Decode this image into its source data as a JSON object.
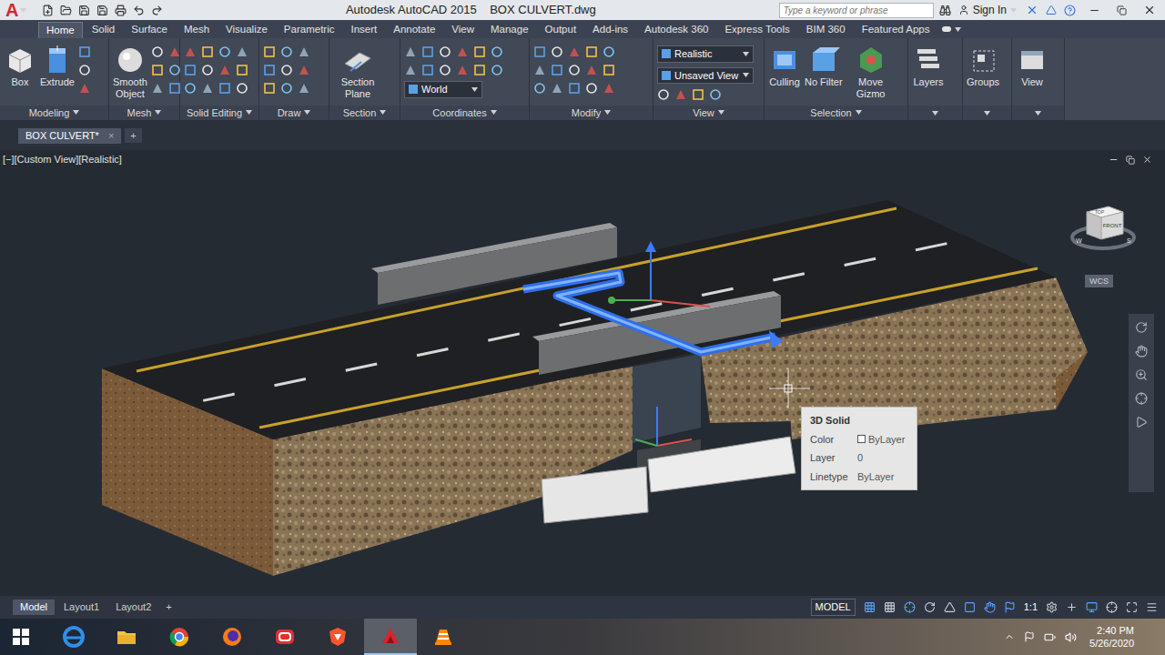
{
  "title_bar": {
    "app_letter": "A",
    "title": "Autodesk AutoCAD 2015    BOX CULVERT.dwg",
    "search_placeholder": "Type a keyword or phrase",
    "sign_in": "Sign In"
  },
  "ribbon_tabs": [
    {
      "label": "Home",
      "selected": true
    },
    {
      "label": "Solid",
      "selected": false
    },
    {
      "label": "Surface",
      "selected": false
    },
    {
      "label": "Mesh",
      "selected": false
    },
    {
      "label": "Visualize",
      "selected": false
    },
    {
      "label": "Parametric",
      "selected": false
    },
    {
      "label": "Insert",
      "selected": false
    },
    {
      "label": "Annotate",
      "selected": false
    },
    {
      "label": "View",
      "selected": false
    },
    {
      "label": "Manage",
      "selected": false
    },
    {
      "label": "Output",
      "selected": false
    },
    {
      "label": "Add-ins",
      "selected": false
    },
    {
      "label": "Autodesk 360",
      "selected": false
    },
    {
      "label": "Express Tools",
      "selected": false
    },
    {
      "label": "BIM 360",
      "selected": false
    },
    {
      "label": "Featured Apps",
      "selected": false
    }
  ],
  "ribbon_panels": [
    {
      "title": "Modeling",
      "buttons": [
        "Box",
        "Extrude"
      ],
      "dropdowns": []
    },
    {
      "title": "Mesh",
      "buttons": [
        "Smooth Object"
      ],
      "dropdowns": []
    },
    {
      "title": "Solid Editing",
      "buttons": [],
      "dropdowns": []
    },
    {
      "title": "Draw",
      "buttons": [],
      "dropdowns": []
    },
    {
      "title": "Section",
      "buttons": [
        "Section Plane"
      ],
      "dropdowns": []
    },
    {
      "title": "Coordinates",
      "buttons": [],
      "dropdowns": [
        "World"
      ]
    },
    {
      "title": "Modify",
      "buttons": [],
      "dropdowns": []
    },
    {
      "title": "View",
      "buttons": [],
      "dropdowns": [
        "Realistic",
        "Unsaved View"
      ]
    },
    {
      "title": "Selection",
      "buttons": [
        "Culling",
        "No Filter",
        "Move Gizmo"
      ],
      "dropdowns": []
    },
    {
      "title": "",
      "buttons": [
        "Layers"
      ],
      "dropdowns": []
    },
    {
      "title": "",
      "buttons": [
        "Groups"
      ],
      "dropdowns": []
    },
    {
      "title": "",
      "buttons": [
        "View"
      ],
      "dropdowns": []
    }
  ],
  "file_tabs": [
    {
      "label": "BOX CULVERT*",
      "selected": true,
      "close": "×"
    }
  ],
  "new_tab": "+",
  "viewport": {
    "label": "[−][Custom View][Realistic]",
    "viewcube": {
      "top": "TOP",
      "front": "FRONT",
      "compass": [
        "W",
        "S"
      ]
    },
    "wcs": "WCS"
  },
  "tooltip": {
    "title": "3D Solid",
    "rows": [
      {
        "label": "Color",
        "value": "ByLayer"
      },
      {
        "label": "Layer",
        "value": "0"
      },
      {
        "label": "Linetype",
        "value": "ByLayer"
      }
    ]
  },
  "layout_tabs": [
    {
      "label": "Model",
      "selected": true
    },
    {
      "label": "Layout1",
      "selected": false
    },
    {
      "label": "Layout2",
      "selected": false
    }
  ],
  "add_layout": "+",
  "status_bar": {
    "model": "MODEL",
    "scale": "1:1"
  },
  "taskbar": {
    "apps": [
      {
        "selected": false
      },
      {
        "selected": false
      },
      {
        "selected": false
      },
      {
        "selected": false
      },
      {
        "selected": false
      },
      {
        "selected": false
      },
      {
        "selected": true
      },
      {
        "selected": false
      }
    ],
    "time": "2:40 PM",
    "date": "5/26/2020"
  }
}
